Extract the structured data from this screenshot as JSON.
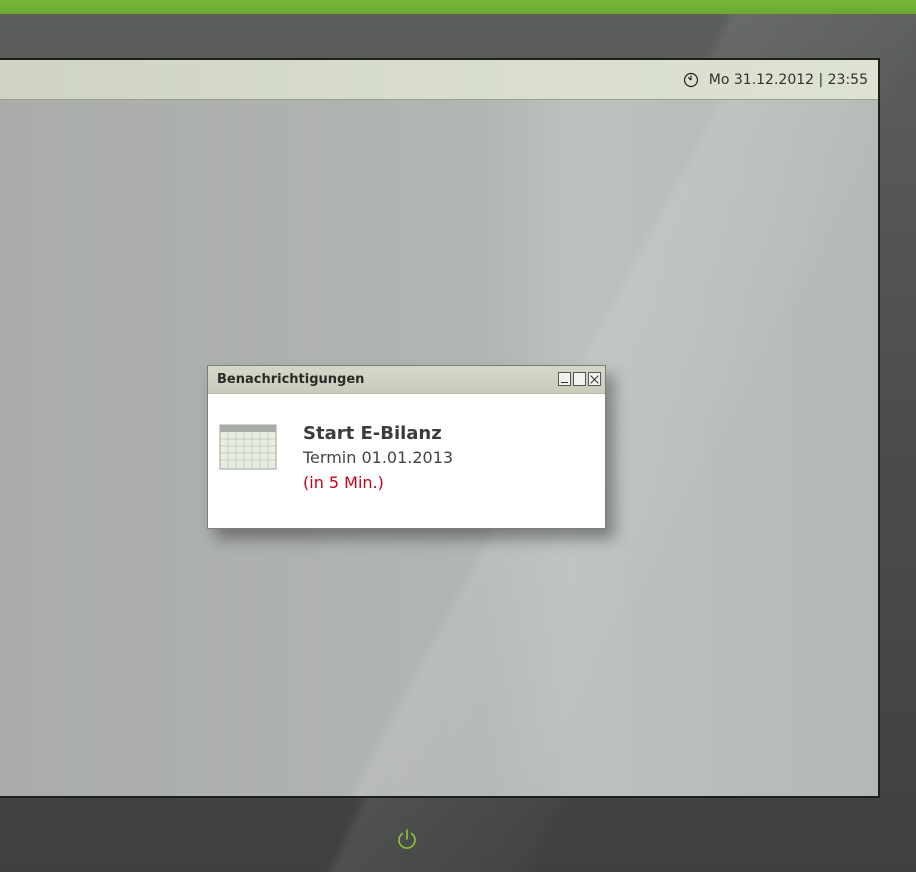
{
  "taskbar": {
    "clock_icon": "clock-icon",
    "datetime": "Mo 31.12.2012 | 23:55"
  },
  "notification": {
    "window_title": "Benachrichtigungen",
    "icon": "calendar-icon",
    "heading": "Start E-Bilanz",
    "line": "Termin 01.01.2013",
    "countdown": "(in 5 Min.)",
    "controls": [
      "minimize",
      "maximize",
      "close"
    ]
  },
  "colors": {
    "brand_green": "#6aa82f",
    "countdown_red": "#c4001a",
    "power_icon": "#8cc63f"
  },
  "device": {
    "power_icon": "power-icon"
  }
}
